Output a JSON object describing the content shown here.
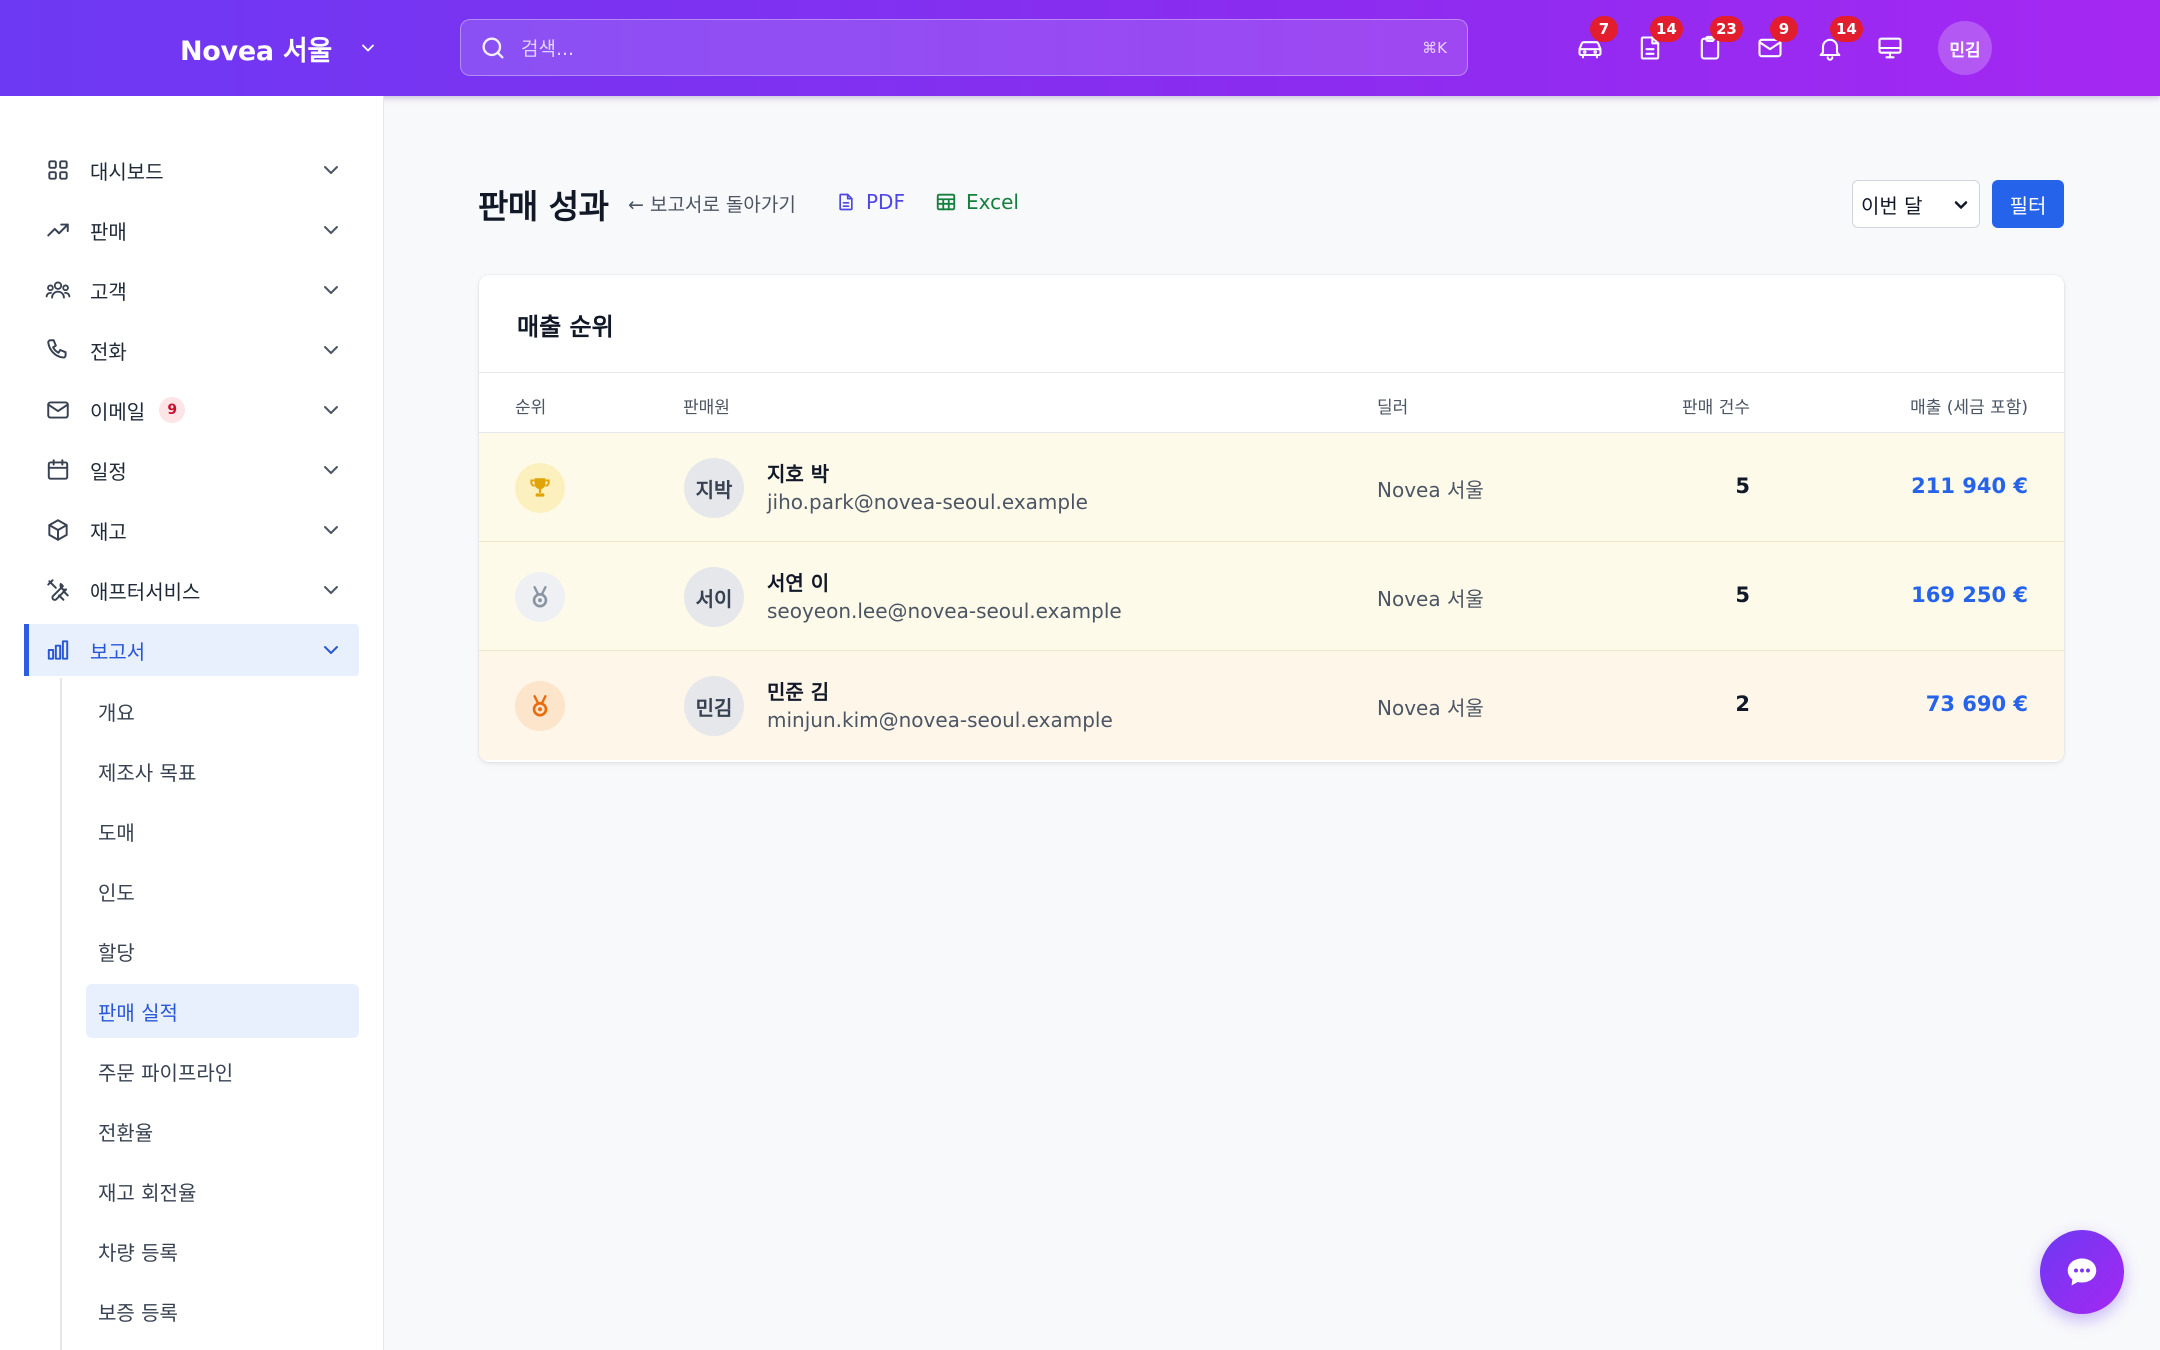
{
  "header": {
    "brand": "Novea 서울",
    "search_placeholder": "검색...",
    "search_shortcut": "⌘K",
    "icons": [
      {
        "name": "car-icon",
        "badge": "7"
      },
      {
        "name": "document-icon",
        "badge": "14"
      },
      {
        "name": "clipboard-icon",
        "badge": "23"
      },
      {
        "name": "mail-icon",
        "badge": "9"
      },
      {
        "name": "bell-icon",
        "badge": "14"
      },
      {
        "name": "monitor-icon",
        "badge": ""
      }
    ],
    "avatar": "민김"
  },
  "sidebar": {
    "items": [
      {
        "label": "대시보드",
        "icon": "grid-icon"
      },
      {
        "label": "판매",
        "icon": "trending-up-icon"
      },
      {
        "label": "고객",
        "icon": "users-icon"
      },
      {
        "label": "전화",
        "icon": "phone-icon"
      },
      {
        "label": "이메일",
        "icon": "mail-icon",
        "badge": "9"
      },
      {
        "label": "일정",
        "icon": "calendar-icon"
      },
      {
        "label": "재고",
        "icon": "box-icon"
      },
      {
        "label": "애프터서비스",
        "icon": "tools-icon"
      },
      {
        "label": "보고서",
        "icon": "bar-chart-icon",
        "active": true
      }
    ],
    "subitems": [
      {
        "label": "개요"
      },
      {
        "label": "제조사 목표"
      },
      {
        "label": "도매"
      },
      {
        "label": "인도"
      },
      {
        "label": "할당"
      },
      {
        "label": "판매 실적",
        "active": true
      },
      {
        "label": "주문 파이프라인"
      },
      {
        "label": "전환율"
      },
      {
        "label": "재고 회전율"
      },
      {
        "label": "차량 등록"
      },
      {
        "label": "보증 등록"
      }
    ]
  },
  "page": {
    "title": "판매 성과",
    "back_label": "← 보고서로 돌아가기",
    "pdf_label": "PDF",
    "excel_label": "Excel",
    "period_value": "이번 달",
    "filter_label": "필터"
  },
  "ranking": {
    "title": "매출 순위",
    "columns": {
      "rank": "순위",
      "salesperson": "판매원",
      "dealer": "딜러",
      "count": "판매 건수",
      "revenue": "매출 (세금 포함)"
    },
    "rows": [
      {
        "rank_icon": "trophy-icon",
        "initials": "지박",
        "name": "지호 박",
        "email": "jiho.park@novea-seoul.example",
        "dealer": "Novea 서울",
        "count": "5",
        "revenue": "211 940 €",
        "bg": "#fefaea",
        "icon_bg": "#fdf0bf",
        "icon_color": "#e1a408"
      },
      {
        "rank_icon": "silver-medal-icon",
        "initials": "서이",
        "name": "서연 이",
        "email": "seoyeon.lee@novea-seoul.example",
        "dealer": "Novea 서울",
        "count": "5",
        "revenue": "169 250 €",
        "bg": "#fefaea",
        "icon_bg": "#eef0f3",
        "icon_color": "#8a94a3"
      },
      {
        "rank_icon": "bronze-medal-icon",
        "initials": "민김",
        "name": "민준 김",
        "email": "minjun.kim@novea-seoul.example",
        "dealer": "Novea 서울",
        "count": "2",
        "revenue": "73 690 €",
        "bg": "#fff6ea",
        "icon_bg": "#fde5cc",
        "icon_color": "#ea6a0c"
      }
    ]
  },
  "colors": {
    "accent": "#2563eb",
    "header_gradient_start": "#6d39f2",
    "header_gradient_end": "#a528f2",
    "badge": "#e11d2e"
  }
}
